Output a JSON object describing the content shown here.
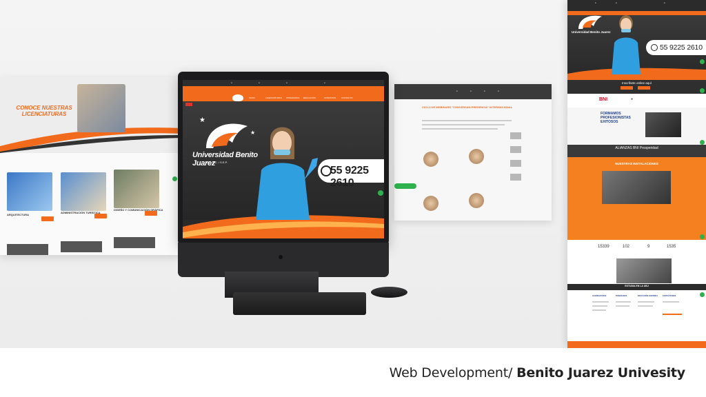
{
  "caption": {
    "prefix": "Web Development/ ",
    "bold": "Benito Juarez Univesity"
  },
  "left_page": {
    "hero_title": "CONOCE NUESTRAS LICENCIATURAS",
    "cards": [
      {
        "label": "ARQUITECTURA"
      },
      {
        "label": "ADMINISTRACIÓN TURÍSTICA"
      },
      {
        "label": "DISEÑO Y COMUNICACIÓN GRÁFICA"
      }
    ]
  },
  "monitor": {
    "brand_line1": "Universidad Benito Juarez",
    "brand_line2": "UBJ",
    "phone": "55 9225 2610",
    "sub": "INC. A.C. / S.E.P."
  },
  "right_small_page": {
    "heading": "CICLO DE WEBINARS \"CONVERSAN PRESENCIA\" INTERNACIONAL"
  },
  "long_page": {
    "phone": "55 9225 2610",
    "inscribete": "Inscríbete online aquí",
    "bni": "BNI",
    "formamos": "FORMAMOS PROFESIONISTAS EXITOSOS",
    "alianzas": "ALIANZAS BNI Prosperidad",
    "instalaciones": "NUESTRAS INSTALACIONES",
    "stats": [
      "15339",
      "102",
      "9",
      "1535"
    ],
    "estudia": "ESTUDIA EN LA UBJ",
    "footer_cols": [
      "LICENCIATURAS",
      "POSGRADOS",
      "EDUCACIÓN CONTINUA",
      "CONTÁCTANOS"
    ]
  },
  "colors": {
    "accent": "#f26a1b",
    "dark": "#2b2b2b",
    "whatsapp": "#2fb14d"
  }
}
